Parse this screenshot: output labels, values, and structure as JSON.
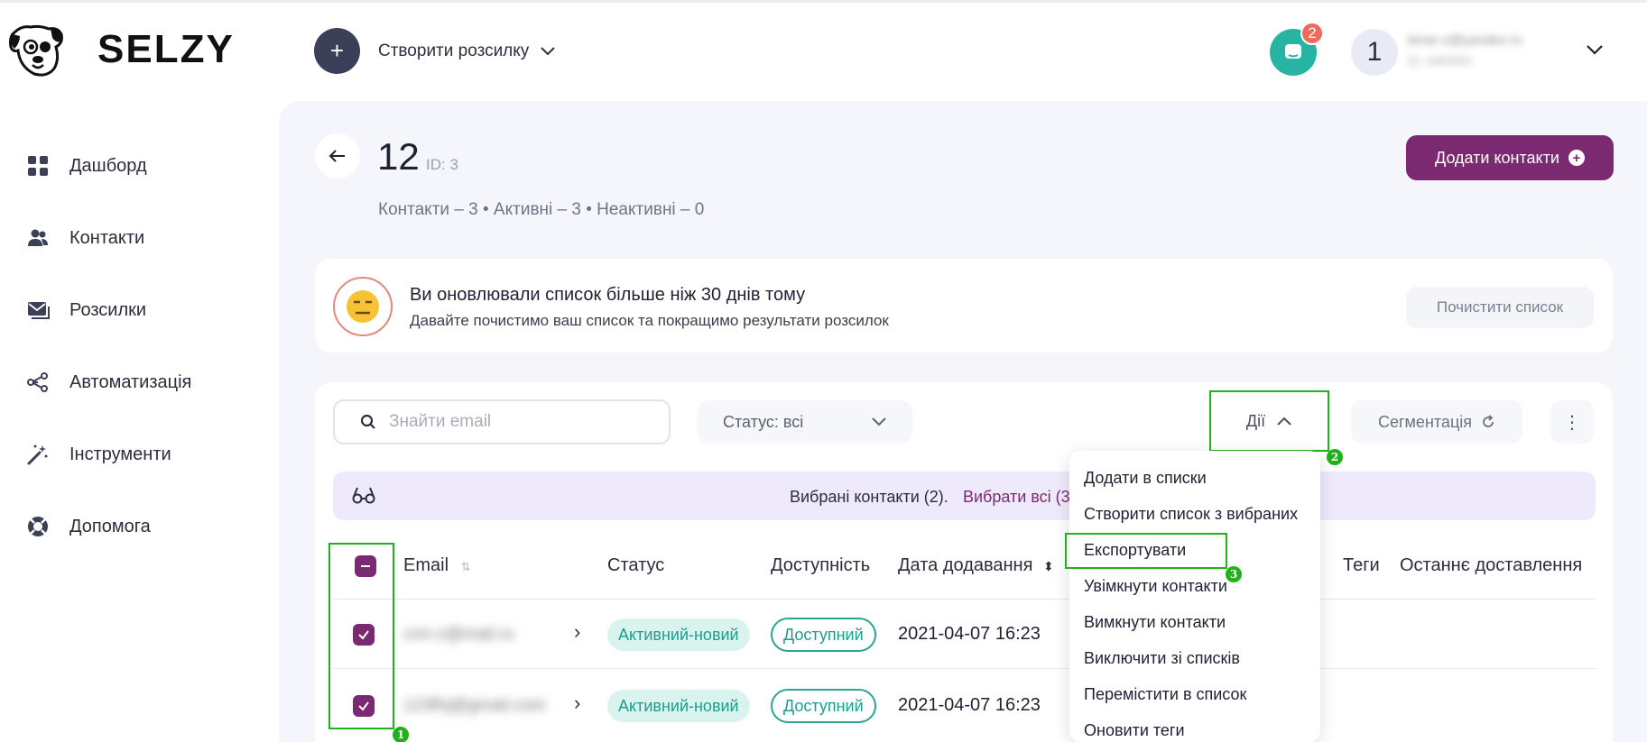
{
  "brand": {
    "name": "SELZY"
  },
  "header": {
    "create_label": "Створити розсилку",
    "notification_count": "2",
    "avatar_initial": "1",
    "account_email": "lenar-z@yandex.ru",
    "account_id": "ID: 4483000"
  },
  "sidebar": {
    "items": [
      {
        "label": "Дашборд",
        "icon": "dashboard-icon"
      },
      {
        "label": "Контакти",
        "icon": "contacts-icon"
      },
      {
        "label": "Розсилки",
        "icon": "mail-icon"
      },
      {
        "label": "Автоматизація",
        "icon": "automation-icon"
      },
      {
        "label": "Інструменти",
        "icon": "magic-wand-icon"
      },
      {
        "label": "Допомога",
        "icon": "help-lifebuoy-icon"
      }
    ]
  },
  "list": {
    "title": "12",
    "id_label": "ID: 3",
    "stats": "Контакти – 3 • Активні – 3 • Неактивні – 0",
    "add_contacts_label": "Додати контакти"
  },
  "banner": {
    "title": "Ви оновлювали список більше ніж 30 днів тому",
    "subtitle": "Давайте почистимо ваш список та покращимо результати розсилок",
    "clean_label": "Почистити список"
  },
  "toolbar": {
    "search_placeholder": "Знайти email",
    "status_filter": "Статус: всі",
    "actions_label": "Дії",
    "segmentation_label": "Сегментація"
  },
  "selection": {
    "text": "Вибрані контакти (2).",
    "select_all": "Вибрати всі (3"
  },
  "table": {
    "columns": [
      "Email",
      "Статус",
      "Доступність",
      "Дата додавання",
      "Теги",
      "Останнє доставлення"
    ],
    "rows": [
      {
        "email": "cnn-z@mail.ru",
        "status": "Активний-новий",
        "availability": "Доступний",
        "date": "2021-04-07 16:23"
      },
      {
        "email": "123fhj@gmail.com",
        "status": "Активний-новий",
        "availability": "Доступний",
        "date": "2021-04-07 16:23"
      }
    ]
  },
  "actions_menu": {
    "items": [
      "Додати в списки",
      "Створити список з вибраних",
      "Експортувати",
      "Увімкнути контакти",
      "Вимкнути контакти",
      "Виключити зі списків",
      "Перемістити в список",
      "Оновити теги"
    ]
  },
  "annotations": {
    "badge_1": "1",
    "badge_2": "2",
    "badge_3": "3"
  },
  "colors": {
    "brand": "#7b2a72",
    "accent_teal": "#27b4a3",
    "highlight": "#22b11a"
  }
}
